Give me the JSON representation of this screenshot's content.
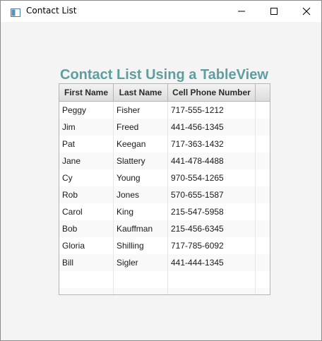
{
  "window": {
    "title": "Contact List"
  },
  "heading": "Contact List Using a TableView",
  "table": {
    "columns": [
      "First Name",
      "Last Name",
      "Cell Phone Number"
    ],
    "rows": [
      [
        "Peggy",
        "Fisher",
        "717-555-1212"
      ],
      [
        "Jim",
        "Freed",
        "441-456-1345"
      ],
      [
        "Pat",
        "Keegan",
        "717-363-1432"
      ],
      [
        "Jane",
        "Slattery",
        "441-478-4488"
      ],
      [
        "Cy",
        "Young",
        "970-554-1265"
      ],
      [
        "Rob",
        "Jones",
        "570-655-1587"
      ],
      [
        "Carol",
        "King",
        "215-547-5958"
      ],
      [
        "Bob",
        "Kauffman",
        "215-456-6345"
      ],
      [
        "Gloria",
        "Shilling",
        "717-785-6092"
      ],
      [
        "Bill",
        "Sigler",
        "441-444-1345"
      ]
    ],
    "empty_rows": 2
  },
  "colors": {
    "heading": "#5f9ea0",
    "window_bg": "#f4f4f4"
  },
  "icons": {
    "app": "window-app-icon",
    "minimize": "minimize-icon",
    "maximize": "maximize-icon",
    "close": "close-icon"
  }
}
